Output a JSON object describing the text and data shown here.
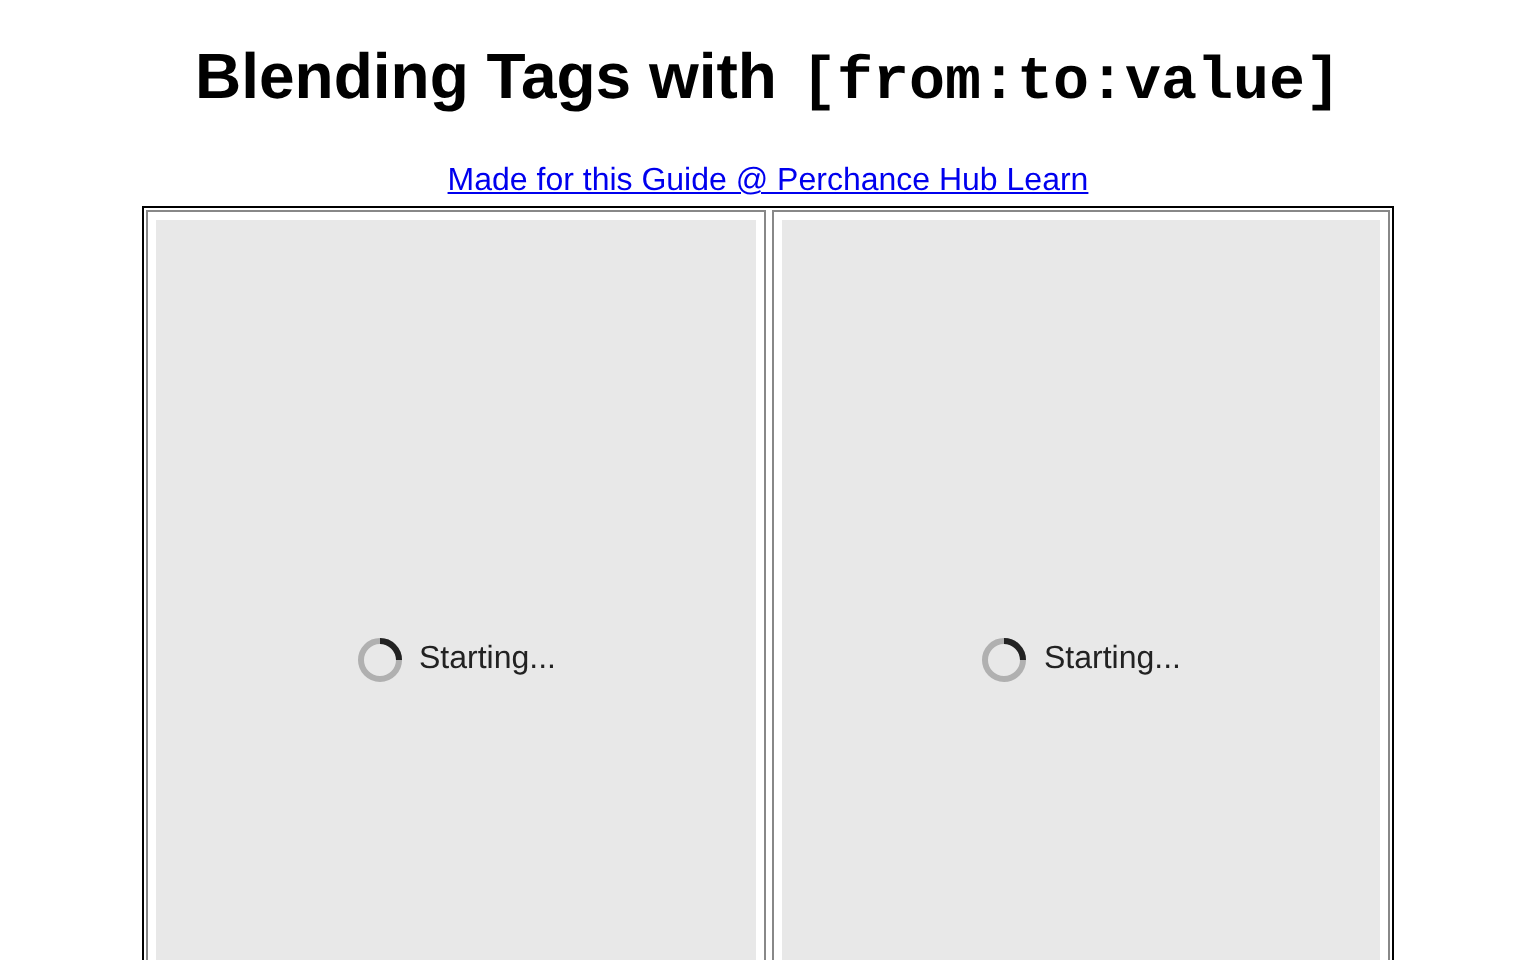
{
  "title": {
    "text": "Blending Tags with",
    "code": "[from:to:value]"
  },
  "link": "Made for this Guide @ Perchance Hub Learn",
  "panels": [
    {
      "status": "Starting..."
    },
    {
      "status": "Starting..."
    }
  ]
}
